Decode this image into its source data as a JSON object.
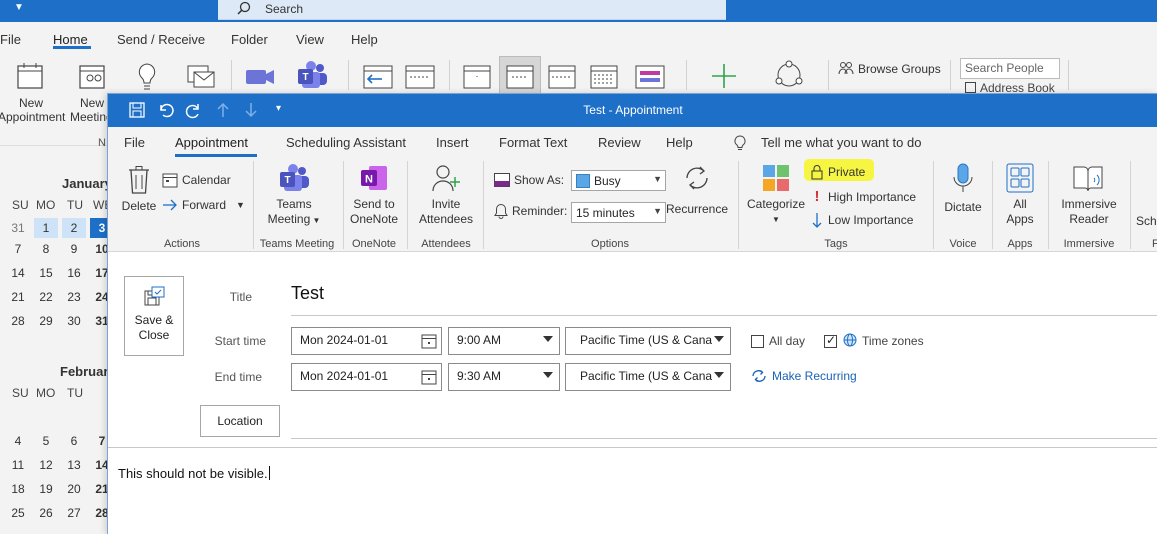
{
  "main_window": {
    "search_placeholder": "Search",
    "menu": [
      "File",
      "Home",
      "Send / Receive",
      "Folder",
      "View",
      "Help"
    ],
    "ribbon": {
      "new_appointment_1": "New",
      "new_appointment_2": "Appointment",
      "new_meeting_1": "New",
      "new_meeting_2": "Meeting",
      "new_group_label_fragment": "N",
      "browse_groups": "Browse Groups",
      "search_people_placeholder": "Search People",
      "address_book": "Address Book"
    },
    "calendar": {
      "january_label": "January",
      "february_label": "February",
      "dow": [
        "SU",
        "MO",
        "TU",
        "WE"
      ],
      "january_weeks": [
        [
          "31",
          "1",
          "2",
          "3"
        ],
        [
          "7",
          "8",
          "9",
          "10"
        ],
        [
          "14",
          "15",
          "16",
          "17"
        ],
        [
          "21",
          "22",
          "23",
          "24"
        ],
        [
          "28",
          "29",
          "30",
          "31"
        ]
      ],
      "february_weeks": [
        [
          "4",
          "5",
          "6",
          "7"
        ],
        [
          "11",
          "12",
          "13",
          "14"
        ],
        [
          "18",
          "19",
          "20",
          "21"
        ],
        [
          "25",
          "26",
          "27",
          "28"
        ]
      ]
    }
  },
  "appointment_window": {
    "title": "Test  -  Appointment",
    "tabs": [
      "File",
      "Appointment",
      "Scheduling Assistant",
      "Insert",
      "Format Text",
      "Review",
      "Help"
    ],
    "tell_me": "Tell me what you want to do",
    "ribbon": {
      "delete": "Delete",
      "calendar": "Calendar",
      "forward": "Forward",
      "actions_label": "Actions",
      "teams_meeting_1": "Teams",
      "teams_meeting_2": "Meeting",
      "teams_meeting_group": "Teams Meeting",
      "send_to_onenote_1": "Send to",
      "send_to_onenote_2": "OneNote",
      "onenote_group": "OneNote",
      "invite_attendees_1": "Invite",
      "invite_attendees_2": "Attendees",
      "attendees_group": "Attendees",
      "show_as_label": "Show As:",
      "show_as_value": "Busy",
      "reminder_label": "Reminder:",
      "reminder_value": "15 minutes",
      "recurrence": "Recurrence",
      "options_group": "Options",
      "categorize": "Categorize",
      "private": "Private",
      "high_importance": "High Importance",
      "low_importance": "Low Importance",
      "tags_group": "Tags",
      "dictate": "Dictate",
      "voice_group": "Voice",
      "all_apps_1": "All",
      "all_apps_2": "Apps",
      "apps_group": "Apps",
      "immersive_reader_1": "Immersive",
      "immersive_reader_2": "Reader",
      "immersive_group": "Immersive",
      "schedule_fragment": "Sche",
      "next_group_fragment": "F"
    },
    "form": {
      "save_close_1": "Save &",
      "save_close_2": "Close",
      "title_label": "Title",
      "title_value": "Test",
      "start_time_label": "Start time",
      "start_date": "Mon 2024-01-01",
      "start_time": "9:00 AM",
      "start_timezone": "Pacific Time (US & Canac",
      "end_time_label": "End time",
      "end_date": "Mon 2024-01-01",
      "end_time": "9:30 AM",
      "end_timezone": "Pacific Time (US & Canac",
      "all_day": "All day",
      "all_day_checked": false,
      "time_zones": "Time zones",
      "time_zones_checked": true,
      "make_recurring": "Make Recurring",
      "location_button": "Location",
      "body_text": "This should not be visible."
    }
  },
  "colors": {
    "title_blue": "#1e6fc7",
    "highlight_yellow": "#f5f542",
    "link_blue": "#1a62b7"
  }
}
